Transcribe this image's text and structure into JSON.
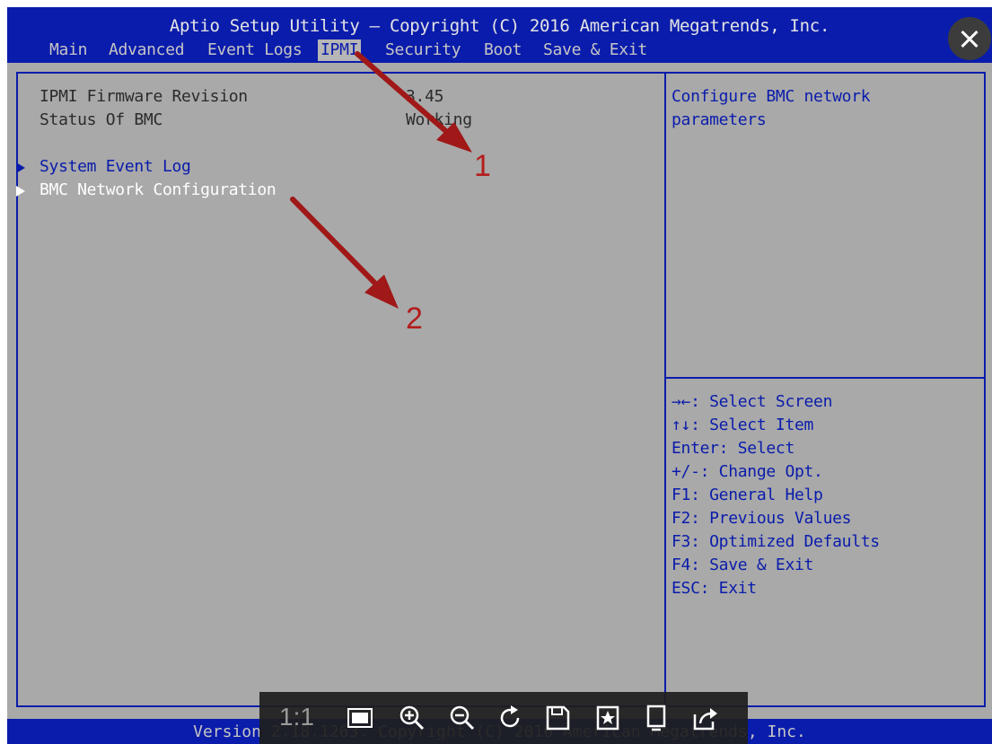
{
  "header": {
    "title": "Aptio Setup Utility – Copyright (C) 2016 American Megatrends, Inc.",
    "tabs": [
      {
        "label": "Main",
        "active": false
      },
      {
        "label": "Advanced",
        "active": false
      },
      {
        "label": "Event Logs",
        "active": false
      },
      {
        "label": "IPMI",
        "active": true
      },
      {
        "label": "Security",
        "active": false
      },
      {
        "label": "Boot",
        "active": false
      },
      {
        "label": "Save & Exit",
        "active": false
      }
    ]
  },
  "main": {
    "info": [
      {
        "label": "IPMI Firmware Revision",
        "value": "3.45"
      },
      {
        "label": "Status Of BMC",
        "value": "Working"
      }
    ],
    "links": [
      {
        "label": "System Event Log",
        "selected": false
      },
      {
        "label": "BMC Network Configuration",
        "selected": true
      }
    ]
  },
  "help": {
    "description_lines": [
      "Configure BMC network",
      "parameters"
    ],
    "keys": [
      "→←: Select Screen",
      "↑↓: Select Item",
      "Enter: Select",
      "+/-: Change Opt.",
      "F1: General Help",
      "F2: Previous Values",
      "F3: Optimized Defaults",
      "F4: Save & Exit",
      "ESC: Exit"
    ]
  },
  "footer": {
    "text": "Version 2.18.1263. Copyright (C) 2016 American Megatrends, Inc."
  },
  "annotations": {
    "label1": "1",
    "label2": "2",
    "color": "#a01818"
  },
  "viewer_toolbar": {
    "ratio_label": "1:1",
    "icons": [
      "fit-screen-icon",
      "zoom-in-icon",
      "zoom-out-icon",
      "rotate-icon",
      "save-icon",
      "bookmark-icon",
      "copy-icon",
      "share-icon"
    ]
  },
  "colors": {
    "bios_blue": "#0a1cab",
    "bios_gray": "#a9a9a9",
    "selected_tab_bg": "#b6b6b6"
  }
}
